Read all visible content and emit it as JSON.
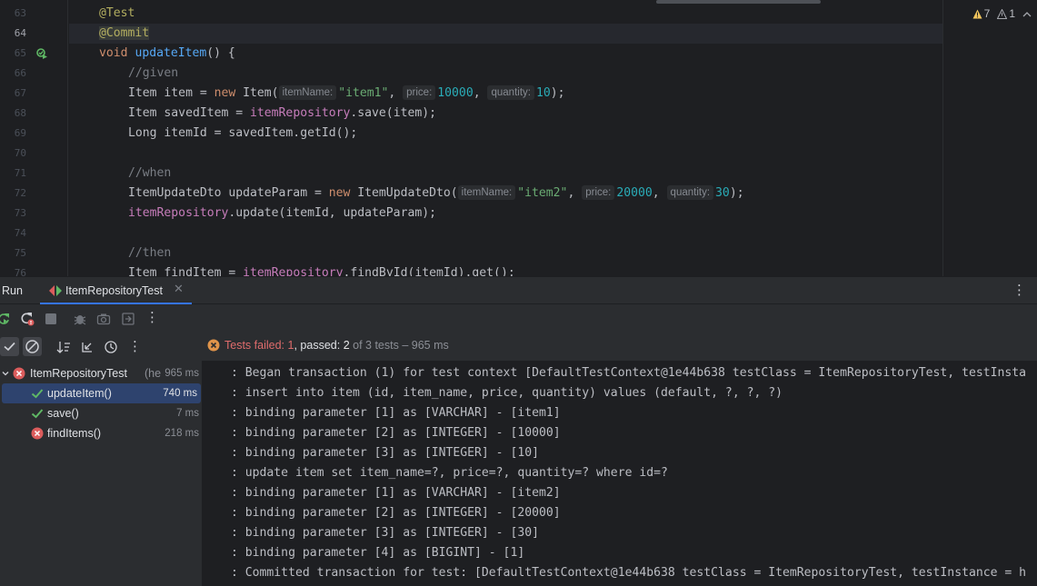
{
  "editor": {
    "lines": [
      {
        "num": "63"
      },
      {
        "num": "64"
      },
      {
        "num": "65"
      },
      {
        "num": "66"
      },
      {
        "num": "67"
      },
      {
        "num": "68"
      },
      {
        "num": "69"
      },
      {
        "num": "70"
      },
      {
        "num": "71"
      },
      {
        "num": "72"
      },
      {
        "num": "73"
      },
      {
        "num": "74"
      },
      {
        "num": "75"
      },
      {
        "num": "76"
      }
    ],
    "code": {
      "l63": "@Test",
      "l64": "@Commit",
      "l65_kw": "void",
      "l65_fn": "updateItem",
      "l65_rest": "() {",
      "l66": "//given",
      "l67_a": "Item item = ",
      "l67_new": "new",
      "l67_b": " Item(",
      "l67_h1": "itemName:",
      "l67_s1": "\"item1\"",
      "l67_c1": ", ",
      "l67_h2": "price:",
      "l67_n1": "10000",
      "l67_c2": ", ",
      "l67_h3": "quantity:",
      "l67_n2": "10",
      "l67_end": ");",
      "l68_a": "Item savedItem = ",
      "l68_f": "itemRepository",
      "l68_b": ".save(item);",
      "l69": "Long itemId = savedItem.getId();",
      "l71": "//when",
      "l72_a": "ItemUpdateDto updateParam = ",
      "l72_new": "new",
      "l72_b": " ItemUpdateDto(",
      "l72_h1": "itemName:",
      "l72_s1": "\"item2\"",
      "l72_c1": ", ",
      "l72_h2": "price:",
      "l72_n1": "20000",
      "l72_c2": ", ",
      "l72_h3": "quantity:",
      "l72_n2": "30",
      "l72_end": ");",
      "l73_f": "itemRepository",
      "l73_b": ".update(itemId, updateParam);",
      "l75": "//then",
      "l76_a": "Item findItem = ",
      "l76_f": "itemRepository",
      "l76_b": ".findById(itemId).get();"
    },
    "inspections": {
      "warnings": "7",
      "weak_warnings": "1"
    }
  },
  "run_panel": {
    "title": "Run",
    "tab_label": "ItemRepositoryTest",
    "status": {
      "failed_label": "Tests failed:",
      "failed_count": "1",
      "sep": ",",
      "passed_label": "passed:",
      "passed_count": "2",
      "rest": "of 3 tests – 965 ms"
    },
    "tree": [
      {
        "name": "ItemRepositoryTest",
        "extra": "(he",
        "time": "965 ms",
        "status": "failed"
      },
      {
        "name": "updateItem()",
        "time": "740 ms",
        "status": "passed"
      },
      {
        "name": "save()",
        "time": "7 ms",
        "status": "passed"
      },
      {
        "name": "findItems()",
        "time": "218 ms",
        "status": "failed"
      }
    ],
    "console": [
      ": Began transaction (1) for test context [DefaultTestContext@1e44b638 testClass = ItemRepositoryTest, testInsta",
      ": insert into item (id, item_name, price, quantity) values (default, ?, ?, ?)",
      ": binding parameter [1] as [VARCHAR] - [item1]",
      ": binding parameter [2] as [INTEGER] - [10000]",
      ": binding parameter [3] as [INTEGER] - [10]",
      ": update item set item_name=?, price=?, quantity=? where id=?",
      ": binding parameter [1] as [VARCHAR] - [item2]",
      ": binding parameter [2] as [INTEGER] - [20000]",
      ": binding parameter [3] as [INTEGER] - [30]",
      ": binding parameter [4] as [BIGINT] - [1]",
      ": Committed transaction for test: [DefaultTestContext@1e44b638 testClass = ItemRepositoryTest, testInstance = h"
    ]
  },
  "colors": {
    "accent": "#3574f0",
    "error": "#db5c5c",
    "success": "#5fb865",
    "warning": "#f2c55c"
  }
}
